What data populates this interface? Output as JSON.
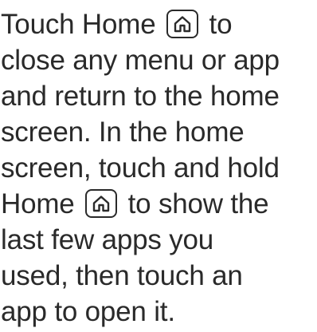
{
  "instructions": {
    "line1": {
      "before": "Touch Home",
      "after": "to"
    },
    "line2": "close any menu or app",
    "line3": "and return to the home",
    "line4": "screen. In the home",
    "line5": "screen, touch and hold",
    "line6": {
      "before": "Home",
      "after": "to show the"
    },
    "line7": "last few apps you",
    "line8": "used, then touch an",
    "line9": "app to open it."
  },
  "icons": {
    "home_key": "home-icon"
  }
}
